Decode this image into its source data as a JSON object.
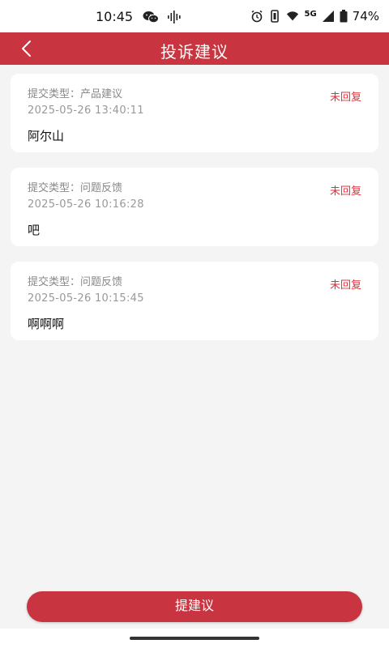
{
  "status_bar": {
    "time": "10:45",
    "network": "5G",
    "battery": "74%",
    "icons": [
      "wechat-icon",
      "voice-icon",
      "alarm-icon",
      "vibrate-icon",
      "wifi-icon",
      "signal-icon",
      "battery-icon"
    ]
  },
  "header": {
    "title": "投诉建议",
    "back_icon": "chevron-left-icon"
  },
  "feedback_list": [
    {
      "type": "提交类型：产品建议",
      "time": "2025-05-26 13:40:11",
      "content": "阿尔山",
      "status": "未回复"
    },
    {
      "type": "提交类型：问题反馈",
      "time": "2025-05-26 10:16:28",
      "content": "吧",
      "status": "未回复"
    },
    {
      "type": "提交类型：问题反馈",
      "time": "2025-05-26 10:15:45",
      "content": "啊啊啊",
      "status": "未回复"
    }
  ],
  "footer": {
    "submit_label": "提建议"
  },
  "colors": {
    "brand": "#c8343f",
    "status_text": "#e0323c",
    "background": "#f4f4f4"
  }
}
